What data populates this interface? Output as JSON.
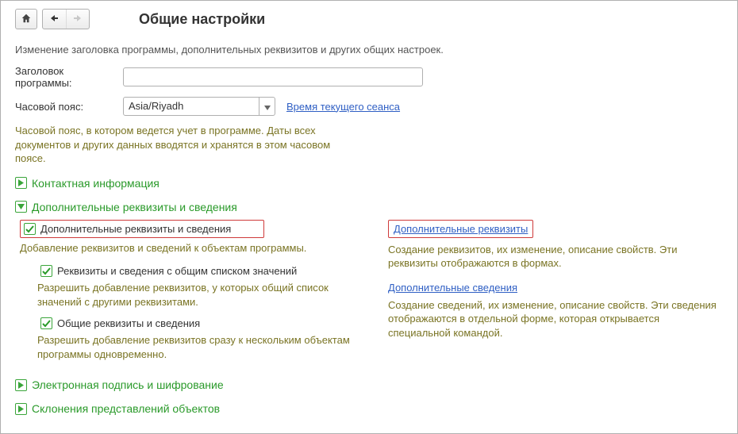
{
  "header": {
    "title": "Общие настройки"
  },
  "description": "Изменение заголовка программы, дополнительных реквизитов и других общих настроек.",
  "form": {
    "program_title_label": "Заголовок программы:",
    "program_title_value": "",
    "timezone_label": "Часовой пояс:",
    "timezone_value": "Asia/Riyadh",
    "session_time_link": "Время текущего сеанса",
    "timezone_hint": "Часовой пояс, в котором ведется учет в программе. Даты всех документов и других данных вводятся и хранятся в этом часовом поясе."
  },
  "sections": {
    "contact_info": "Контактная информация",
    "additional_props": "Дополнительные реквизиты и сведения",
    "digital_signature": "Электронная подпись и шифрование",
    "declensions": "Склонения представлений объектов"
  },
  "additional": {
    "checkbox_main": "Дополнительные реквизиты и сведения",
    "main_hint": "Добавление реквизитов и сведений к объектам программы.",
    "checkbox_shared_list": "Реквизиты и сведения с общим списком значений",
    "shared_list_hint": "Разрешить добавление реквизитов, у которых общий список значений с другими реквизитами.",
    "checkbox_common": "Общие реквизиты и сведения",
    "common_hint": "Разрешить добавление реквизитов сразу к нескольким объектам программы одновременно.",
    "link_requisites": "Дополнительные реквизиты",
    "requisites_hint": "Создание реквизитов, их изменение, описание свойств. Эти реквизиты отображаются в формах.",
    "link_info": "Дополнительные сведения",
    "info_hint": "Создание сведений, их изменение, описание свойств. Эти сведения отображаются в отдельной форме, которая открывается специальной командой."
  }
}
